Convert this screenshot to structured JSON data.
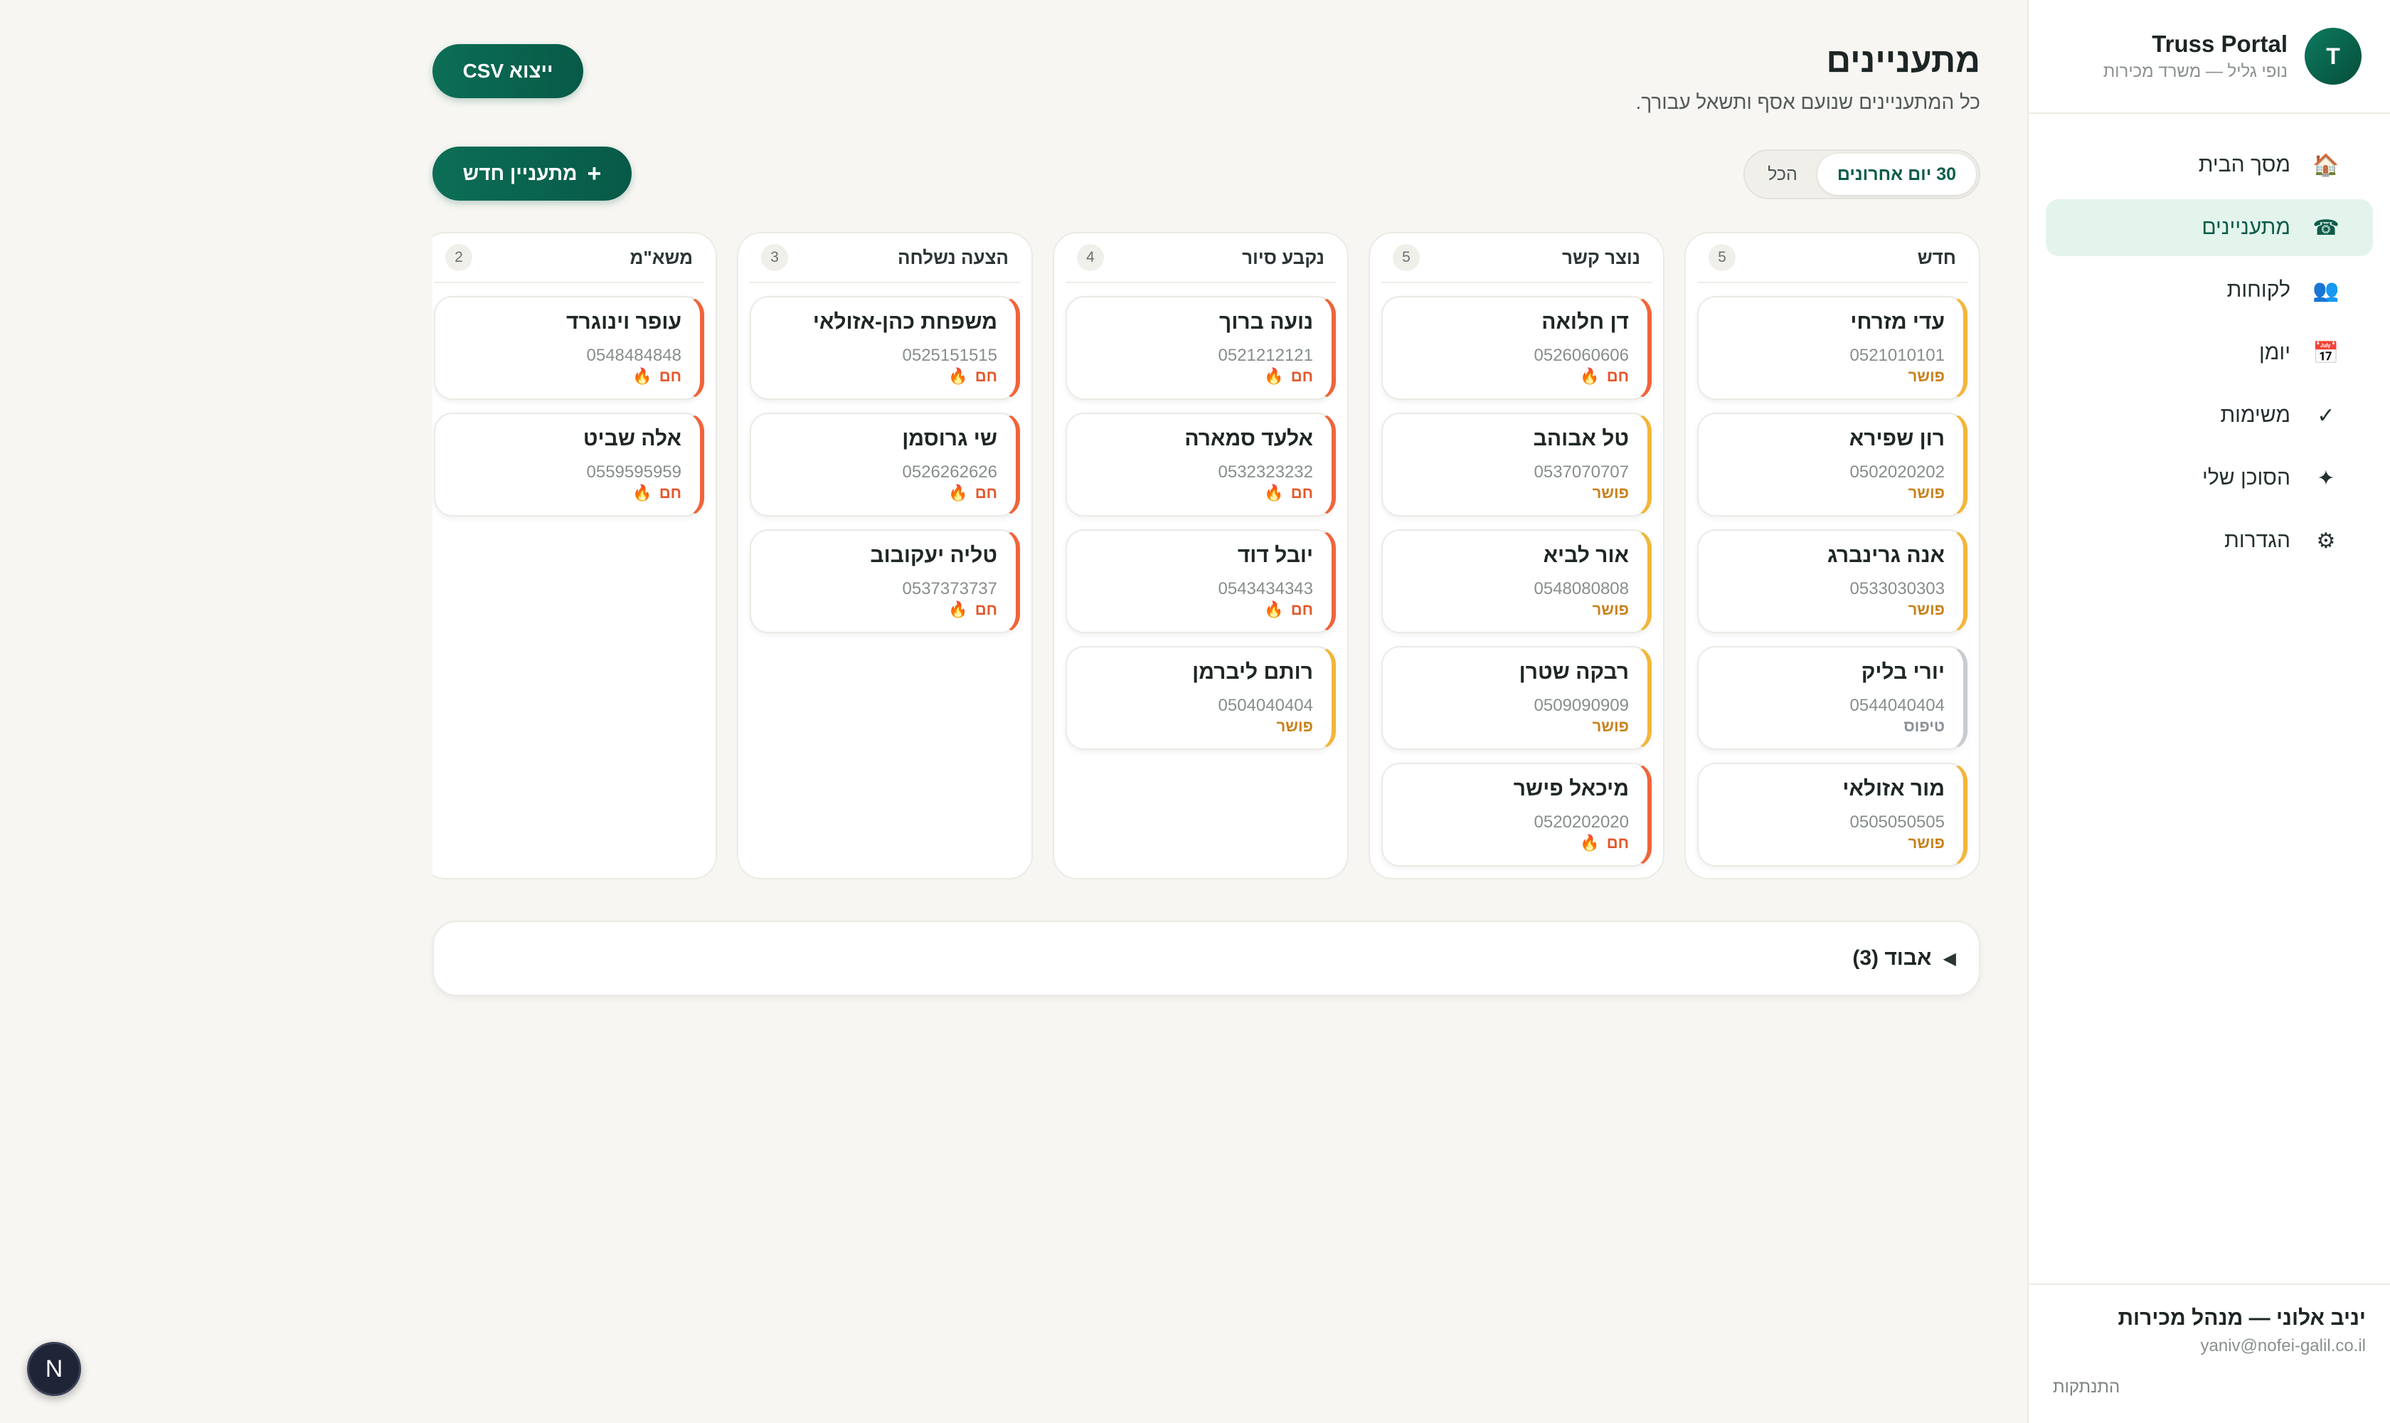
{
  "app": {
    "avatar_letter": "T",
    "title": "Truss Portal",
    "subtitle": "נופי גליל — משרד מכירות"
  },
  "nav": [
    {
      "label": "מסך הבית",
      "icon": "🏠",
      "icon_name": "home-icon",
      "active": false
    },
    {
      "label": "מתעניינים",
      "icon": "☎",
      "icon_name": "phone-icon",
      "active": true
    },
    {
      "label": "לקוחות",
      "icon": "👥",
      "icon_name": "people-icon",
      "active": false
    },
    {
      "label": "יומן",
      "icon": "📅",
      "icon_name": "calendar-icon",
      "active": false
    },
    {
      "label": "משימות",
      "icon": "✓",
      "icon_name": "check-icon",
      "active": false
    },
    {
      "label": "הסוכן שלי",
      "icon": "✦",
      "icon_name": "sparkle-icon",
      "active": false
    },
    {
      "label": "הגדרות",
      "icon": "⚙",
      "icon_name": "gear-icon",
      "active": false
    }
  ],
  "user": {
    "name": "יניב אלוני — מנהל מכירות",
    "email": "yaniv@nofei-galil.co.il",
    "logout": "התנתקות"
  },
  "header": {
    "title": "מתעניינים",
    "subtitle": "כל המתעניינים שנועם אסף ותשאל עבורך.",
    "export_button": "ייצוא CSV",
    "new_button": "מתעניין חדש",
    "new_button_icon": "+"
  },
  "filter": {
    "options": [
      "30 יום אחרונים",
      "הכל"
    ],
    "selected": "30 יום אחרונים"
  },
  "temperatures": {
    "hot": {
      "label": "חם",
      "color": "#f0643a"
    },
    "warm": {
      "label": "פושר",
      "color": "#f2b63a"
    },
    "cold": {
      "label": "טיפוס",
      "color": "#c8ccd0"
    }
  },
  "columns": [
    {
      "title": "חדש",
      "count": "5",
      "cards": [
        {
          "name": "עדי מזרחי",
          "phone": "0521010101",
          "temp": "warm"
        },
        {
          "name": "רון שפירא",
          "phone": "0502020202",
          "temp": "warm"
        },
        {
          "name": "אנה גרינברג",
          "phone": "0533030303",
          "temp": "warm"
        },
        {
          "name": "יורי בליק",
          "phone": "0544040404",
          "temp": "cold"
        },
        {
          "name": "מור אזולאי",
          "phone": "0505050505",
          "temp": "warm"
        }
      ]
    },
    {
      "title": "נוצר קשר",
      "count": "5",
      "cards": [
        {
          "name": "דן חלואה",
          "phone": "0526060606",
          "temp": "hot"
        },
        {
          "name": "טל אבוהב",
          "phone": "0537070707",
          "temp": "warm"
        },
        {
          "name": "אור לביא",
          "phone": "0548080808",
          "temp": "warm"
        },
        {
          "name": "רבקה שטרן",
          "phone": "0509090909",
          "temp": "warm"
        },
        {
          "name": "מיכאל פישר",
          "phone": "0520202020",
          "temp": "hot"
        }
      ]
    },
    {
      "title": "נקבע סיור",
      "count": "4",
      "cards": [
        {
          "name": "נועה ברוך",
          "phone": "0521212121",
          "temp": "hot"
        },
        {
          "name": "אלעד סמארה",
          "phone": "0532323232",
          "temp": "hot"
        },
        {
          "name": "יובל דוד",
          "phone": "0543434343",
          "temp": "hot"
        },
        {
          "name": "רותם ליברמן",
          "phone": "0504040404",
          "temp": "warm"
        }
      ]
    },
    {
      "title": "הצעה נשלחה",
      "count": "3",
      "cards": [
        {
          "name": "משפחת כהן-אזולאי",
          "phone": "0525151515",
          "temp": "hot"
        },
        {
          "name": "שי גרוסמן",
          "phone": "0526262626",
          "temp": "hot"
        },
        {
          "name": "טליה יעקובוב",
          "phone": "0537373737",
          "temp": "hot"
        }
      ]
    },
    {
      "title": "משא\"מ",
      "count": "2",
      "cards": [
        {
          "name": "עופר וינוגרד",
          "phone": "0548484848",
          "temp": "hot"
        },
        {
          "name": "אלה שביט",
          "phone": "0559595959",
          "temp": "hot"
        }
      ]
    }
  ],
  "lost": {
    "arrow": "◀",
    "label": "אבוד (3)"
  },
  "fab": {
    "letter": "N"
  }
}
